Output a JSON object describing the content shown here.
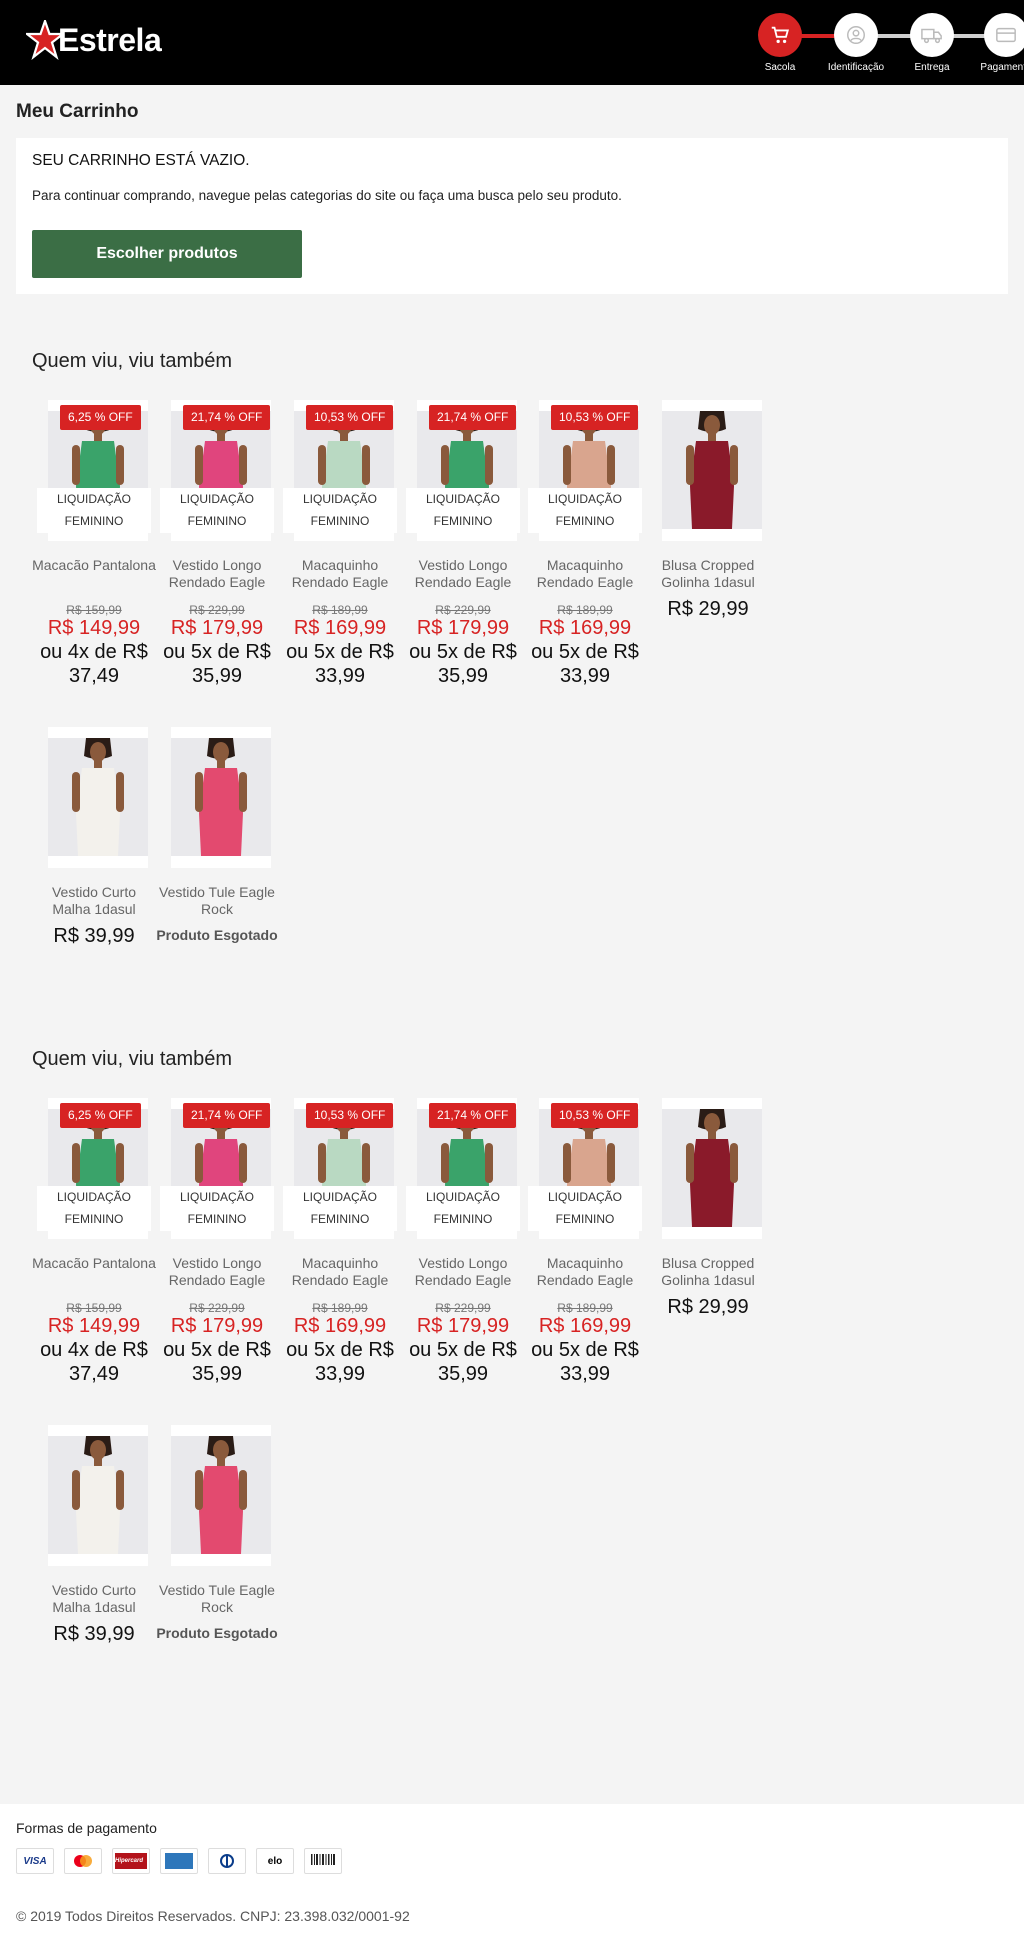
{
  "header": {
    "logo_text": "Estrela",
    "steps": [
      {
        "label": "Sacola",
        "icon": "cart-icon"
      },
      {
        "label": "Identificação",
        "icon": "user-icon"
      },
      {
        "label": "Entrega",
        "icon": "truck-icon"
      },
      {
        "label": "Pagamento",
        "icon": "credit-card-icon"
      }
    ]
  },
  "cart": {
    "title": "Meu Carrinho",
    "empty_text": "SEU CARRINHO ESTÁ VAZIO.",
    "hint": "Para continuar comprando, navegue pelas categorias do site ou faça uma busca pelo seu produto.",
    "button_label": "Escolher produtos"
  },
  "shelves": [
    {
      "title": "Quem viu, viu também",
      "products": [
        {
          "badge": "6,25 % OFF",
          "tag": "LIQUIDAÇÃO FEMININO",
          "name": "Macacão Pantalona",
          "old_price": "R$ 159,99",
          "price": "R$ 149,99",
          "installment": "ou 4x de R$ 37,49"
        },
        {
          "badge": "21,74 % OFF",
          "tag": "LIQUIDAÇÃO FEMININO",
          "name": "Vestido Longo Rendado Eagle",
          "old_price": "R$ 229,99",
          "price": "R$ 179,99",
          "installment": "ou 5x de R$ 35,99"
        },
        {
          "badge": "10,53 % OFF",
          "tag": "LIQUIDAÇÃO FEMININO",
          "name": "Macaquinho Rendado Eagle",
          "old_price": "R$ 189,99",
          "price": "R$ 169,99",
          "installment": "ou 5x de R$ 33,99"
        },
        {
          "badge": "21,74 % OFF",
          "tag": "LIQUIDAÇÃO FEMININO",
          "name": "Vestido Longo Rendado Eagle",
          "old_price": "R$ 229,99",
          "price": "R$ 179,99",
          "installment": "ou 5x de R$ 35,99"
        },
        {
          "badge": "10,53 % OFF",
          "tag": "LIQUIDAÇÃO FEMININO",
          "name": "Macaquinho Rendado Eagle",
          "old_price": "R$ 189,99",
          "price": "R$ 169,99",
          "installment": "ou 5x de R$ 33,99"
        },
        {
          "name": "Blusa Cropped Golinha 1dasul",
          "price": "R$ 29,99"
        },
        {
          "name": "Vestido Curto Malha 1dasul",
          "price": "R$ 39,99"
        },
        {
          "name": "Vestido Tule Eagle Rock",
          "soldout": "Produto Esgotado"
        }
      ]
    },
    {
      "title": "Quem viu, viu também",
      "products": [
        {
          "badge": "6,25 % OFF",
          "tag": "LIQUIDAÇÃO FEMININO",
          "name": "Macacão Pantalona",
          "old_price": "R$ 159,99",
          "price": "R$ 149,99",
          "installment": "ou 4x de R$ 37,49"
        },
        {
          "badge": "21,74 % OFF",
          "tag": "LIQUIDAÇÃO FEMININO",
          "name": "Vestido Longo Rendado Eagle",
          "old_price": "R$ 229,99",
          "price": "R$ 179,99",
          "installment": "ou 5x de R$ 35,99"
        },
        {
          "badge": "10,53 % OFF",
          "tag": "LIQUIDAÇÃO FEMININO",
          "name": "Macaquinho Rendado Eagle",
          "old_price": "R$ 189,99",
          "price": "R$ 169,99",
          "installment": "ou 5x de R$ 33,99"
        },
        {
          "badge": "21,74 % OFF",
          "tag": "LIQUIDAÇÃO FEMININO",
          "name": "Vestido Longo Rendado Eagle",
          "old_price": "R$ 229,99",
          "price": "R$ 179,99",
          "installment": "ou 5x de R$ 35,99"
        },
        {
          "badge": "10,53 % OFF",
          "tag": "LIQUIDAÇÃO FEMININO",
          "name": "Macaquinho Rendado Eagle",
          "old_price": "R$ 189,99",
          "price": "R$ 169,99",
          "installment": "ou 5x de R$ 33,99"
        },
        {
          "name": "Blusa Cropped Golinha 1dasul",
          "price": "R$ 29,99"
        },
        {
          "name": "Vestido Curto Malha 1dasul",
          "price": "R$ 39,99"
        },
        {
          "name": "Vestido Tule Eagle Rock",
          "soldout": "Produto Esgotado"
        }
      ]
    }
  ],
  "footer": {
    "payment_title": "Formas de pagamento",
    "payment_methods": [
      "VISA",
      "Mastercard",
      "Hipercard",
      "Amex",
      "Diners",
      "elo",
      "Boleto"
    ],
    "copyright": "© 2019 Todos Direitos Reservados. CNPJ: 23.398.032/0001-92"
  },
  "colors": {
    "accent_red": "#d72323",
    "button_green": "#3b6e45",
    "header_black": "#000000"
  }
}
